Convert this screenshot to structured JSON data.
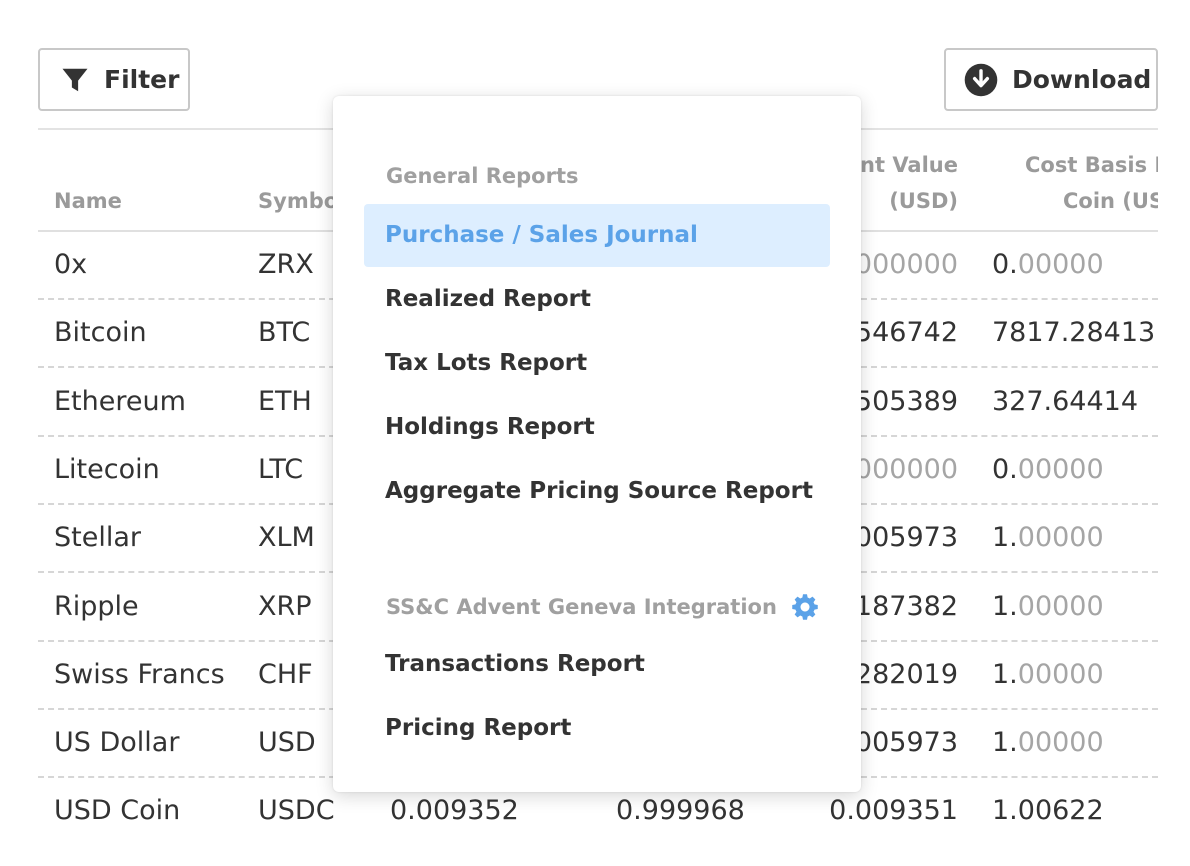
{
  "toolbar": {
    "filter_label": "Filter",
    "download_label": "Download"
  },
  "table": {
    "headers": {
      "name": "Name",
      "symbol": "Symbo",
      "current_value_line1": "ent Value",
      "current_value_line2": "(USD)",
      "cost_basis_line1": "Cost Basis P",
      "cost_basis_line2": "Coin (US"
    },
    "rows": [
      {
        "name": "0x",
        "symbol": "ZRX",
        "n1": "",
        "n2": "",
        "cur": "000000",
        "cost_int": "0.",
        "cost_dec": "00000"
      },
      {
        "name": "Bitcoin",
        "symbol": "BTC",
        "n1": "",
        "n2": "",
        "cur": "546742",
        "cost_int": "7817.28413",
        "cost_dec": ""
      },
      {
        "name": "Ethereum",
        "symbol": "ETH",
        "n1": "",
        "n2": "",
        "cur": "505389",
        "cost_int": "327.64414",
        "cost_dec": ""
      },
      {
        "name": "Litecoin",
        "symbol": "LTC",
        "n1": "",
        "n2": "",
        "cur": "000000",
        "cost_int": "0.",
        "cost_dec": "00000"
      },
      {
        "name": "Stellar",
        "symbol": "XLM",
        "n1": "",
        "n2": "",
        "cur": "005973",
        "cost_int": "1.",
        "cost_dec": "00000"
      },
      {
        "name": "Ripple",
        "symbol": "XRP",
        "n1": "",
        "n2": "",
        "cur": "187382",
        "cost_int": "1.",
        "cost_dec": "00000"
      },
      {
        "name": "Swiss Francs",
        "symbol": "CHF",
        "n1": "",
        "n2": "",
        "cur": "282019",
        "cost_int": "1.",
        "cost_dec": "00000"
      },
      {
        "name": "US Dollar",
        "symbol": "USD",
        "n1": "",
        "n2": "",
        "cur": "005973",
        "cost_int": "1.",
        "cost_dec": "00000"
      },
      {
        "name": "USD Coin",
        "symbol": "USDC",
        "n1": "0.009352",
        "n2": "0.999968",
        "cur": "0.009351",
        "cost_int": "1.00622",
        "cost_dec": ""
      }
    ]
  },
  "menu": {
    "general_heading": "General Reports",
    "general_items": [
      {
        "label": "Purchase / Sales Journal",
        "active": true
      },
      {
        "label": "Realized Report",
        "active": false
      },
      {
        "label": "Tax Lots Report",
        "active": false
      },
      {
        "label": "Holdings Report",
        "active": false
      },
      {
        "label": "Aggregate Pricing Source Report",
        "active": false
      }
    ],
    "integration_heading": "SS&C Advent Geneva Integration",
    "integration_items": [
      {
        "label": "Transactions Report"
      },
      {
        "label": "Pricing Report"
      }
    ]
  },
  "icons": {
    "filter": "filter-funnel-icon",
    "download": "download-circle-icon",
    "settings": "gear-icon"
  },
  "colors": {
    "accent": "#5ba2e8",
    "active_bg": "#ddeeff",
    "text": "#333333",
    "muted": "#a5a5a5"
  }
}
